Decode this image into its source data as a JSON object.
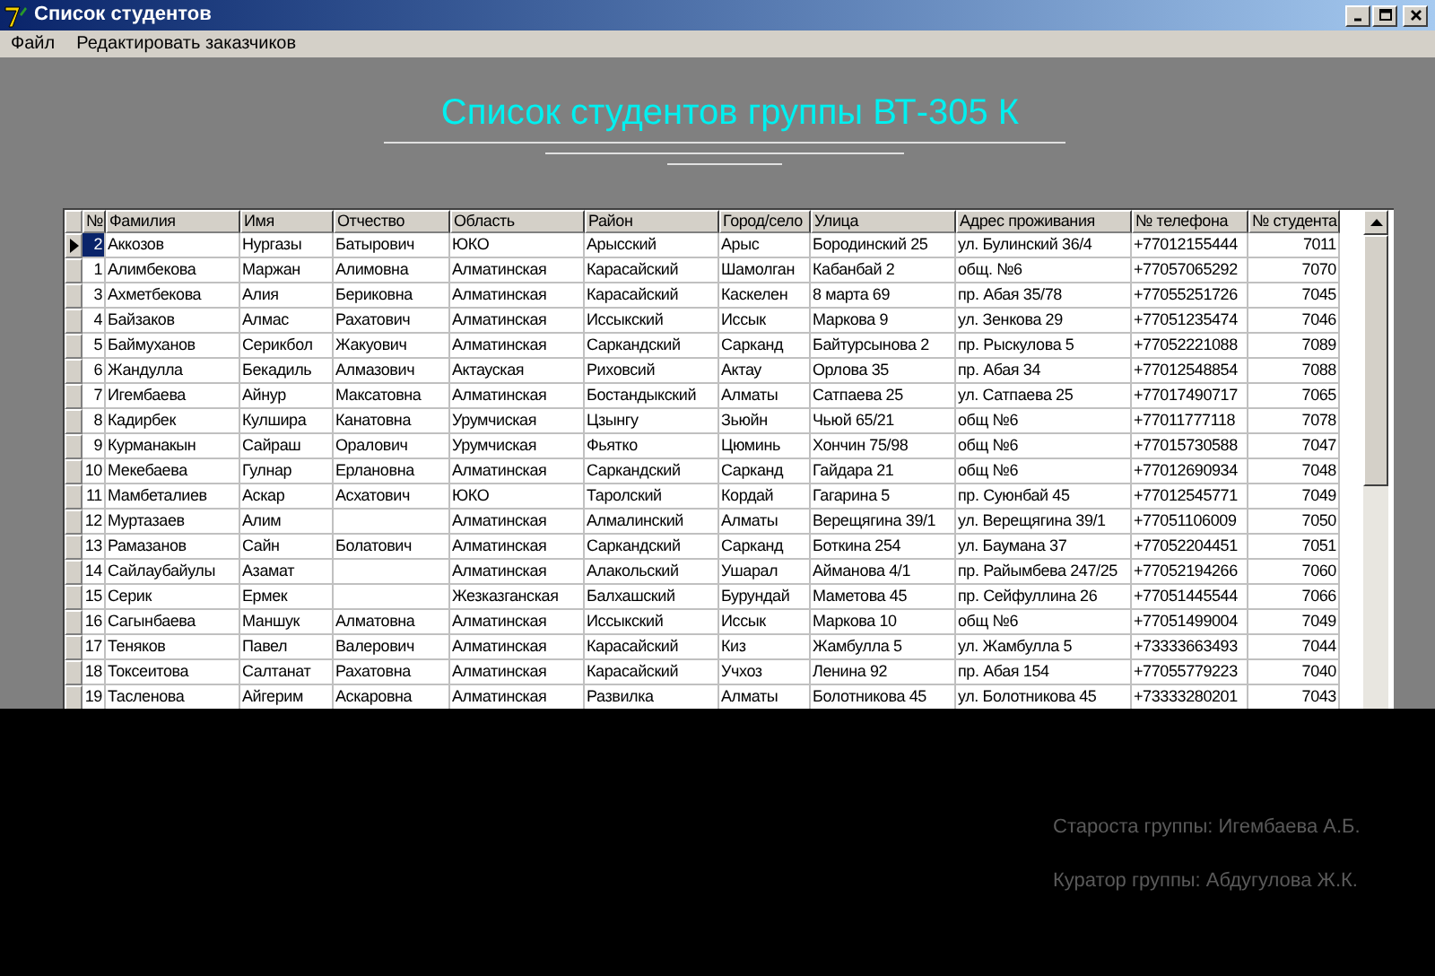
{
  "window": {
    "title": "Список студентов"
  },
  "menu": [
    "Файл",
    "Редактировать заказчиков"
  ],
  "heading": "Список студентов группы ВТ-305 К",
  "table": {
    "columns": [
      "№",
      "Фамилия",
      "Имя",
      "Отчество",
      "Область",
      "Район",
      "Город/село",
      "Улица",
      "Адрес проживания",
      "№ телефона",
      "№ студента"
    ],
    "rows": [
      {
        "selected": true,
        "cells": [
          "2",
          "Аккозов",
          "Нургазы",
          "Батырович",
          "ЮКО",
          "Арысский",
          "Арыс",
          "Бородинский 25",
          "ул. Булинский 36/4",
          "+77012155444",
          "7011"
        ]
      },
      {
        "selected": false,
        "cells": [
          "1",
          "Алимбекова",
          "Маржан",
          "Алимовна",
          "Алматинская",
          "Карасайский",
          "Шамолган",
          "Кабанбай 2",
          "общ. №6",
          "+77057065292",
          "7070"
        ]
      },
      {
        "selected": false,
        "cells": [
          "3",
          "Ахметбекова",
          "Алия",
          "Бериковна",
          "Алматинская",
          "Карасайский",
          "Каскелен",
          "8 марта 69",
          "пр. Абая 35/78",
          "+77055251726",
          "7045"
        ]
      },
      {
        "selected": false,
        "cells": [
          "4",
          "Байзаков",
          "Алмас",
          "Рахатович",
          "Алматинская",
          "Иссыкский",
          "Иссык",
          "Маркова 9",
          "ул. Зенкова 29",
          "+77051235474",
          "7046"
        ]
      },
      {
        "selected": false,
        "cells": [
          "5",
          "Баймуханов",
          "Серикбол",
          "Жакуович",
          "Алматинская",
          "Саркандский",
          "Сарканд",
          "Байтурсынова 2",
          "пр. Рыскулова 5",
          "+77052221088",
          "7089"
        ]
      },
      {
        "selected": false,
        "cells": [
          "6",
          "Жандулла",
          "Бекадиль",
          "Алмазович",
          "Актауская",
          "Риховсий",
          "Актау",
          "Орлова 35",
          "пр. Абая 34",
          "+77012548854",
          "7088"
        ]
      },
      {
        "selected": false,
        "cells": [
          "7",
          "Игембаева",
          "Айнур",
          "Максатовна",
          "Алматинская",
          "Бостандыкский",
          "Алматы",
          "Сатпаева 25",
          "ул. Сатпаева 25",
          "+77017490717",
          "7065"
        ]
      },
      {
        "selected": false,
        "cells": [
          "8",
          "Кадирбек",
          "Кулшира",
          "Канатовна",
          "Урумчиская",
          "Цзынгу",
          "Зьюйн",
          "Чьюй 65/21",
          "общ №6",
          "+77011777118",
          "7078"
        ]
      },
      {
        "selected": false,
        "cells": [
          "9",
          "Курманакын",
          "Сайраш",
          "Оралович",
          "Урумчиская",
          "Фьятко",
          "Цюминь",
          "Хончин 75/98",
          "общ №6",
          "+77015730588",
          "7047"
        ]
      },
      {
        "selected": false,
        "cells": [
          "10",
          "Мекебаева",
          "Гулнар",
          "Ерлановна",
          "Алматинская",
          "Саркандский",
          "Сарканд",
          "Гайдара 21",
          "общ №6",
          "+77012690934",
          "7048"
        ]
      },
      {
        "selected": false,
        "cells": [
          "11",
          "Мамбеталиев",
          "Аскар",
          "Асхатович",
          "ЮКО",
          "Таролский",
          "Кордай",
          "Гагарина 5",
          "пр. Суюнбай 45",
          "+77012545771",
          "7049"
        ]
      },
      {
        "selected": false,
        "cells": [
          "12",
          "Муртазаев",
          "Алим",
          "",
          "Алматинская",
          "Алмалинский",
          "Алматы",
          "Верещягина 39/1",
          "ул. Верещягина 39/1",
          "+77051106009",
          "7050"
        ]
      },
      {
        "selected": false,
        "cells": [
          "13",
          "Рамазанов",
          "Сайн",
          "Болатович",
          "Алматинская",
          "Саркандский",
          "Сарканд",
          "Боткина 254",
          "ул. Баумана 37",
          "+77052204451",
          "7051"
        ]
      },
      {
        "selected": false,
        "cells": [
          "14",
          "Сайлаубайулы",
          "Азамат",
          "",
          "Алматинская",
          "Алакольский",
          "Ушарал",
          "Айманова 4/1",
          "пр. Райымбева 247/25",
          "+77052194266",
          "7060"
        ]
      },
      {
        "selected": false,
        "cells": [
          "15",
          "Серик",
          "Ермек",
          "",
          "Жезказганская",
          "Балхашский",
          "Бурундай",
          "Маметова 45",
          "пр. Сейфуллина 26",
          "+77051445544",
          "7066"
        ]
      },
      {
        "selected": false,
        "cells": [
          "16",
          "Сагынбаева",
          "Маншук",
          "Алматовна",
          "Алматинская",
          "Иссыкский",
          "Иссык",
          "Маркова 10",
          "общ №6",
          "+77051499004",
          "7049"
        ]
      },
      {
        "selected": false,
        "cells": [
          "17",
          "Теняков",
          "Павел",
          "Валерович",
          "Алматинская",
          "Карасайский",
          "Киз",
          "Жамбулла 5",
          "ул. Жамбулла 5",
          "+73333663493",
          "7044"
        ]
      },
      {
        "selected": false,
        "cells": [
          "18",
          "Токсеитова",
          "Салтанат",
          "Рахатовна",
          "Алматинская",
          "Карасайский",
          "Учхоз",
          "Ленина 92",
          "пр. Абая 154",
          "+77055779223",
          "7040"
        ]
      },
      {
        "selected": false,
        "cells": [
          "19",
          "Тасленова",
          "Айгерим",
          "Аскаровна",
          "Алматинская",
          "Развилка",
          "Алматы",
          "Болотникова 45",
          "ул. Болотникова 45",
          "+73333280201",
          "7043"
        ]
      }
    ]
  },
  "footer": [
    "Староста группы: Игембаева А.Б.",
    "Куратор группы: Абдугулова Ж.К."
  ]
}
